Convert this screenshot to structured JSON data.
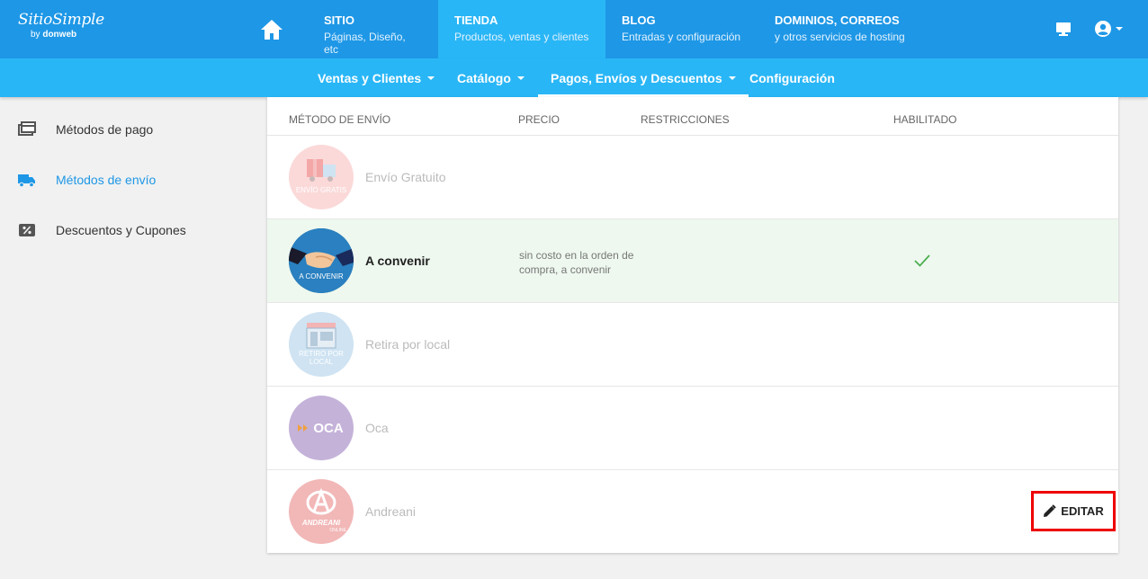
{
  "brand": {
    "name": "SitioSimple",
    "by_prefix": "by",
    "by_name": "donweb"
  },
  "topnav": {
    "tabs": [
      {
        "title": "SITIO",
        "subtitle": "Páginas, Diseño, etc"
      },
      {
        "title": "TIENDA",
        "subtitle": "Productos, ventas y clientes"
      },
      {
        "title": "BLOG",
        "subtitle": "Entradas y configuración"
      },
      {
        "title": "DOMINIOS, CORREOS",
        "subtitle": "y otros servicios de hosting"
      }
    ],
    "active_tab": "TIENDA"
  },
  "subnav": {
    "items": [
      {
        "label": "Ventas y Clientes"
      },
      {
        "label": "Catálogo"
      },
      {
        "label": "Pagos, Envíos y Descuentos"
      },
      {
        "label": "Configuración"
      }
    ],
    "active": "Pagos, Envíos y Descuentos"
  },
  "sidebar": {
    "items": [
      {
        "label": "Métodos de pago",
        "icon": "wallet-icon"
      },
      {
        "label": "Métodos de envío",
        "icon": "truck-icon"
      },
      {
        "label": "Descuentos y Cupones",
        "icon": "percent-tag-icon"
      }
    ],
    "active": "Métodos de envío"
  },
  "table": {
    "headers": {
      "method": "MÉTODO DE ENVÍO",
      "price": "PRECIO",
      "restrictions": "RESTRICCIONES",
      "enabled": "HABILITADO"
    },
    "rows": [
      {
        "name": "Envío Gratuito",
        "avatar_text": "ENVÍO GRATIS",
        "price": "",
        "enabled": false
      },
      {
        "name": "A convenir",
        "avatar_text": "A CONVENIR",
        "price": "sin costo en la orden de compra, a convenir",
        "enabled": true
      },
      {
        "name": "Retira por local",
        "avatar_text": "RETIRO POR LOCAL",
        "price": "",
        "enabled": false
      },
      {
        "name": "Oca",
        "avatar_text": "OCA",
        "price": "",
        "enabled": false
      },
      {
        "name": "Andreani",
        "avatar_text": "ANDREANI",
        "avatar_subtext": "ONLINE",
        "price": "",
        "enabled": false
      }
    ]
  },
  "edit_button": {
    "label": "EDITAR",
    "icon": "pencil-icon"
  },
  "colors": {
    "topbar": "#1e97e6",
    "subbar": "#29b6f6",
    "selected_row": "#eef8ef",
    "check": "#4caf50",
    "highlight_box": "#e00000"
  }
}
